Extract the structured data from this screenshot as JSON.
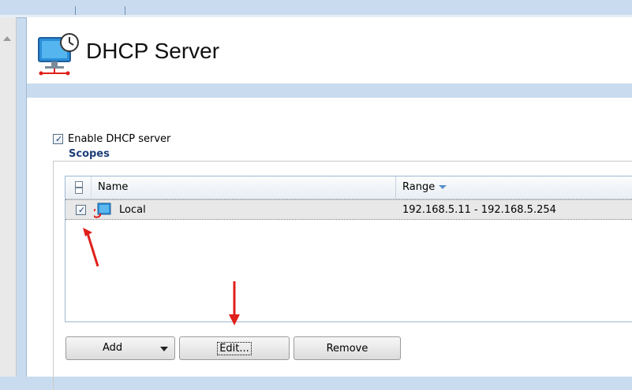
{
  "page": {
    "title": "DHCP Server"
  },
  "enable_dhcp": {
    "label": "Enable DHCP server",
    "checked": true
  },
  "scopes": {
    "legend": "Scopes",
    "columns": {
      "name": "Name",
      "range": "Range"
    },
    "rows": [
      {
        "checked": true,
        "name": "Local",
        "range": "192.168.5.11 - 192.168.5.254"
      }
    ]
  },
  "buttons": {
    "add": "Add",
    "edit": "Edit...",
    "remove": "Remove"
  },
  "colors": {
    "accent": "#c9dcef",
    "legend": "#1d3f78",
    "arrow": "#e0201a"
  },
  "icons": {
    "page": "dhcp-monitor-icon",
    "row": "scope-network-icon"
  }
}
